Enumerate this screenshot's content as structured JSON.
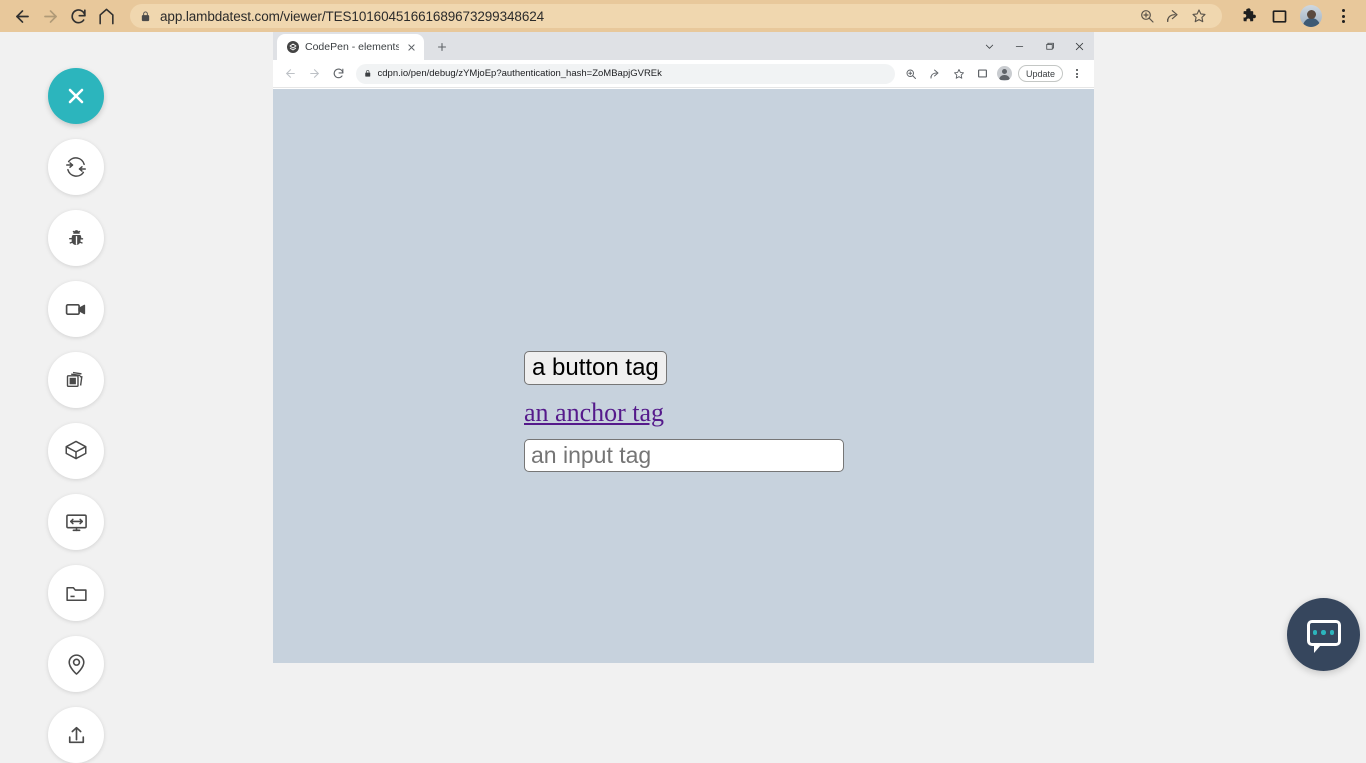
{
  "outer_browser": {
    "url": "app.lambdatest.com/viewer/TES10160451661689673299348624",
    "back_icon": "back-arrow-icon",
    "forward_icon": "forward-arrow-icon",
    "reload_icon": "reload-icon",
    "home_icon": "home-icon",
    "lock_icon": "lock-icon",
    "zoom_icon": "zoom-in-icon",
    "share_icon": "share-icon",
    "bookmark_icon": "star-icon",
    "extensions_icon": "puzzle-piece-icon",
    "sidepanel_icon": "side-panel-icon",
    "avatar_icon": "user-avatar",
    "menu_icon": "kebab-menu-icon",
    "toolbar_color": "#e8c89b",
    "omnibox_color": "#f0d7af"
  },
  "sidebar": {
    "background": "#f1f1f1",
    "accent": "#2cb5bd",
    "items": [
      {
        "name": "close-session",
        "icon": "close-x-icon",
        "primary": true
      },
      {
        "name": "rotate-device",
        "icon": "rotate-sync-icon",
        "primary": false
      },
      {
        "name": "report-bug",
        "icon": "bug-icon",
        "primary": false
      },
      {
        "name": "record-video",
        "icon": "video-camera-icon",
        "primary": false
      },
      {
        "name": "screenshots",
        "icon": "gallery-stack-icon",
        "primary": false
      },
      {
        "name": "devtools-cube",
        "icon": "cube-icon",
        "primary": false
      },
      {
        "name": "resize-viewport",
        "icon": "monitor-resize-icon",
        "primary": false
      },
      {
        "name": "files",
        "icon": "folder-icon",
        "primary": false
      },
      {
        "name": "geolocation",
        "icon": "map-pin-icon",
        "primary": false
      },
      {
        "name": "upload",
        "icon": "upload-icon",
        "primary": false
      }
    ]
  },
  "inner_browser": {
    "tab": {
      "title": "CodePen - elements with default",
      "favicon": "codepen-favicon",
      "close_icon": "tab-close-icon"
    },
    "new_tab_icon": "plus-icon",
    "window_controls": {
      "chevron_icon": "chevron-down-icon",
      "minimize_icon": "minimize-icon",
      "maximize_icon": "maximize-icon",
      "close_icon": "close-icon"
    },
    "back_icon": "back-arrow-icon",
    "forward_icon": "forward-arrow-icon",
    "reload_icon": "reload-icon",
    "lock_icon": "lock-icon",
    "url": "cdpn.io/pen/debug/zYMjoEp?authentication_hash=ZoMBapjGVREk",
    "zoom_icon": "zoom-in-icon",
    "share_icon": "share-icon",
    "bookmark_icon": "star-icon",
    "sidepanel_icon": "side-panel-icon",
    "profile_icon": "profile-icon",
    "update_label": "Update",
    "menu_icon": "kebab-menu-icon"
  },
  "page": {
    "background": "#c7d2dd",
    "button_label": "a button tag",
    "anchor_label": "an anchor tag",
    "anchor_color": "#551a8b",
    "input_placeholder": "an input tag",
    "input_value": ""
  },
  "chat_widget": {
    "name": "support-chat-button",
    "icon": "chat-bubble-icon",
    "background": "#36465d",
    "dot_color": "#2cb5bd"
  }
}
